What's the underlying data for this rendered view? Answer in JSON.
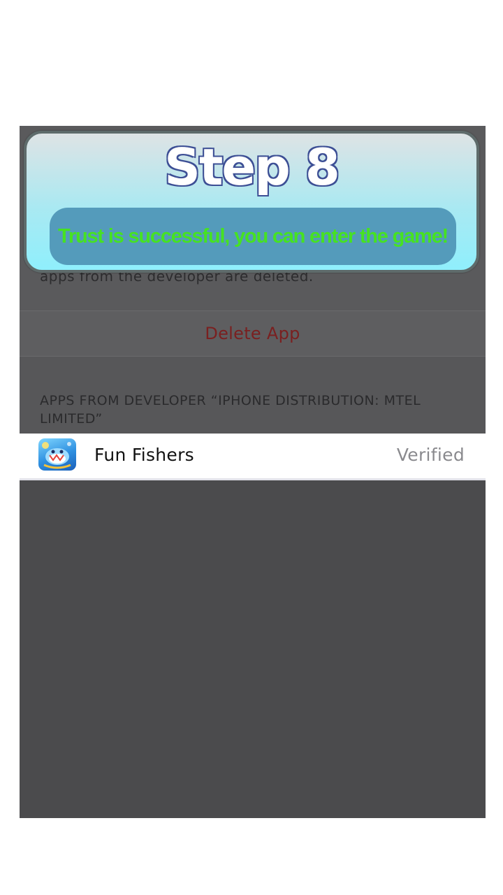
{
  "overlay": {
    "title": "Step 8",
    "message": "Trust is successful, you can enter the game!"
  },
  "settings": {
    "description_fragment": "apps from the developer are deleted.",
    "delete_label": "Delete App",
    "section_header": "APPS FROM DEVELOPER “IPHONE DISTRIBUTION: MTEL LIMITED”",
    "apps": [
      {
        "name": "Fun Fishers",
        "status": "Verified",
        "icon": "fun-fishers-app-icon"
      }
    ]
  },
  "colors": {
    "title_fill": "#ffffff",
    "title_outline": "#3d4f95",
    "message_text": "#46e222",
    "message_bg": "#549bbb",
    "delete_text": "#7a2020",
    "dimmed_bg": "#4b4b4d"
  }
}
